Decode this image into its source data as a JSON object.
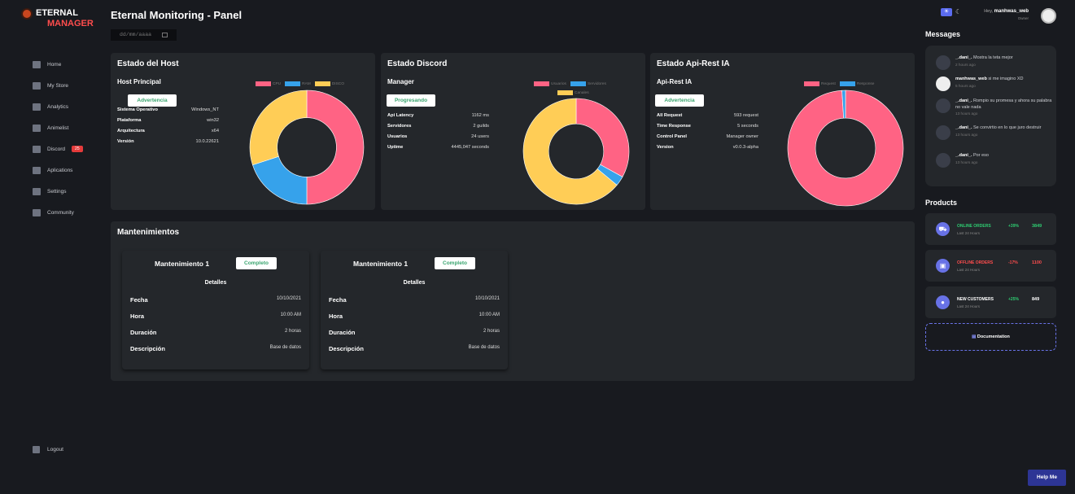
{
  "brand": {
    "line1": "ETERNAL",
    "line2": "MANAGER"
  },
  "sidebar": {
    "items": [
      {
        "label": "Home",
        "icon": "grid-icon"
      },
      {
        "label": "My Store",
        "icon": "store-icon"
      },
      {
        "label": "Analytics",
        "icon": "chart-icon"
      },
      {
        "label": "Animelist",
        "icon": "tools-icon"
      },
      {
        "label": "Discord",
        "icon": "chat-icon",
        "badge": "25"
      },
      {
        "label": "Aplications",
        "icon": "code-icon"
      },
      {
        "label": "Settings",
        "icon": "gear-icon"
      },
      {
        "label": "Community",
        "icon": "people-icon"
      }
    ],
    "logout": "Logout"
  },
  "header": {
    "title": "Eternal Monitoring - Panel",
    "date_placeholder": "dd/mm/aaaa",
    "greeting": "Hey,",
    "username": "manhwas_web",
    "role": "Owner"
  },
  "host": {
    "title": "Estado del Host",
    "subtitle": "Host Principal",
    "status": "Advertencia",
    "rows": [
      {
        "k": "Sistema Operativo",
        "v": "Windows_NT"
      },
      {
        "k": "Plataforma",
        "v": "win32"
      },
      {
        "k": "Arquitectura",
        "v": "x64"
      },
      {
        "k": "Versión",
        "v": "10.0.22621"
      }
    ]
  },
  "discord": {
    "title": "Estado Discord",
    "subtitle": "Manager",
    "status": "Progresando",
    "rows": [
      {
        "k": "Api Latency",
        "v": "1162 ms"
      },
      {
        "k": "Servidores",
        "v": "2 guilds"
      },
      {
        "k": "Usuarios",
        "v": "24 users"
      },
      {
        "k": "Uptime",
        "v": "4445,047 seconds"
      }
    ]
  },
  "api": {
    "title": "Estado Api-Rest IA",
    "subtitle": "Api-Rest IA",
    "status": "Advertencia",
    "rows": [
      {
        "k": "All Request",
        "v": "593 request"
      },
      {
        "k": "Time Response",
        "v": "5 seconds"
      },
      {
        "k": "Control Panel",
        "v": "Manager owner"
      },
      {
        "k": "Version",
        "v": "v0.0.3-alpha"
      }
    ]
  },
  "chart_data": [
    {
      "type": "pie",
      "categories": [
        "CPU",
        "RAM",
        "DISCO"
      ],
      "values": [
        50,
        20,
        30
      ],
      "colors": [
        "#ff6384",
        "#36a2eb",
        "#ffcd56"
      ]
    },
    {
      "type": "pie",
      "categories": [
        "Usuarios",
        "Servidores",
        "Canales"
      ],
      "values": [
        33,
        3,
        64
      ],
      "colors": [
        "#ff6384",
        "#36a2eb",
        "#ffcd56"
      ]
    },
    {
      "type": "pie",
      "categories": [
        "Request",
        "Response"
      ],
      "values": [
        99,
        1
      ],
      "colors": [
        "#ff6384",
        "#36a2eb"
      ]
    }
  ],
  "maintenance": {
    "title": "Mantenimientos",
    "cards": [
      {
        "name": "Mantenimiento 1",
        "status": "Completo",
        "details": "Detalles",
        "rows": [
          {
            "k": "Fecha",
            "v": "10/10/2021"
          },
          {
            "k": "Hora",
            "v": "10:00 AM"
          },
          {
            "k": "Duración",
            "v": "2 horas"
          },
          {
            "k": "Descripción",
            "v": "Base de datos"
          }
        ]
      },
      {
        "name": "Mantenimiento 1",
        "status": "Completo",
        "details": "Detalles",
        "rows": [
          {
            "k": "Fecha",
            "v": "10/10/2021"
          },
          {
            "k": "Hora",
            "v": "10:00 AM"
          },
          {
            "k": "Duración",
            "v": "2 horas"
          },
          {
            "k": "Descripción",
            "v": "Base de datos"
          }
        ]
      }
    ]
  },
  "messages": {
    "title": "Messages",
    "items": [
      {
        "user": "_.dani_.",
        "text": "Mostra la teta mejor",
        "time": "2 hours ago"
      },
      {
        "user": "manhwas_web",
        "text": "si me imagino XD",
        "time": "5 hours ago"
      },
      {
        "user": "_.dani_.",
        "text": "Rompio su promesa y ahora su palabra no vale nada",
        "time": "13 hours ago"
      },
      {
        "user": "_.dani_.",
        "text": "Se convirtio en lo que juro destruir",
        "time": "13 hours ago"
      },
      {
        "user": "_.dani_.",
        "text": "Por eso",
        "time": "13 hours ago"
      }
    ]
  },
  "products": {
    "title": "Products",
    "items": [
      {
        "label": "ONLINE ORDERS",
        "sub": "Last 24 Hours",
        "pct": "+39%",
        "value": "3849",
        "color": "#2ecc71",
        "icon": "cart-icon"
      },
      {
        "label": "OFFLINE ORDERS",
        "sub": "Last 24 Hours",
        "pct": "-17%",
        "value": "1100",
        "color": "#ff4d4d",
        "icon": "bag-icon"
      },
      {
        "label": "NEW CUSTOMERS",
        "sub": "Last 24 Hours",
        "pct": "+25%",
        "value": "849",
        "color": "#ffffff",
        "icon": "user-icon"
      }
    ],
    "doc": "Documentation"
  },
  "help": "Help Me"
}
